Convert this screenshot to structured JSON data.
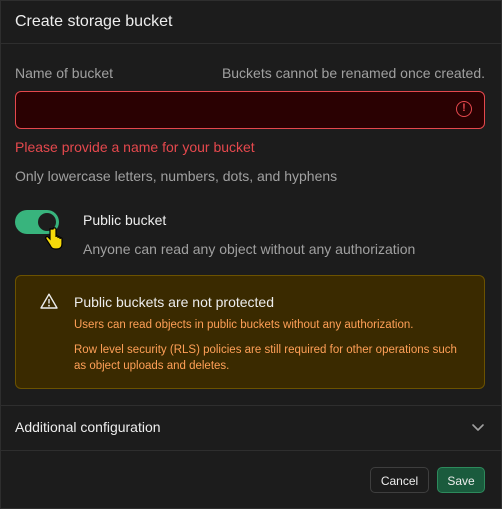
{
  "dialog": {
    "title": "Create storage bucket"
  },
  "name_field": {
    "label": "Name of bucket",
    "note": "Buckets cannot be renamed once created.",
    "value": "",
    "placeholder": "",
    "error_icon": "!",
    "error": "Please provide a name for your bucket",
    "hint": "Only lowercase letters, numbers, dots, and hyphens"
  },
  "public_toggle": {
    "label": "Public bucket",
    "description": "Anyone can read any object without any authorization",
    "checked": true,
    "accent": "#3ecf8e"
  },
  "warning": {
    "title": "Public buckets are not protected",
    "line1": "Users can read objects in public buckets without any authorization.",
    "line2": "Row level security (RLS) policies are still required for other operations such as object uploads and deletes.",
    "icon": "warning-triangle-icon",
    "color": "#ffa057"
  },
  "additional": {
    "label": "Additional configuration",
    "icon": "chevron-down-icon"
  },
  "footer": {
    "cancel_label": "Cancel",
    "save_label": "Save"
  }
}
